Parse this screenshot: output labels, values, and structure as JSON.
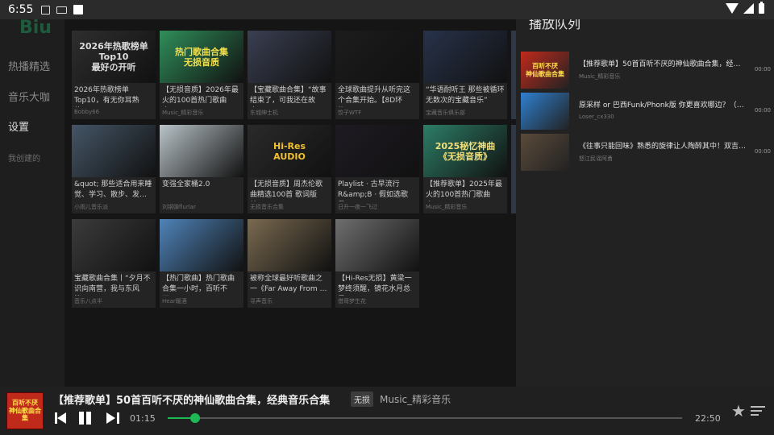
{
  "statusbar": {
    "time": "6:55"
  },
  "sidebar": {
    "logo": "Biu",
    "items": [
      {
        "label": "热播精选"
      },
      {
        "label": "音乐大咖"
      },
      {
        "label": "设置"
      }
    ],
    "section": "我创建的"
  },
  "grid": {
    "cards": [
      {
        "title": "2026年热歌榜单Top10，有无你耳熟的…",
        "author": "Bobby66",
        "overlay": "2026年热歌榜单Top10\n最好の开听",
        "bg": "#2e2e2e",
        "fg": "#dddddd"
      },
      {
        "title": "【无损音质】2026年最火的100首热门歌曲合…",
        "author": "Music_精彩音乐",
        "overlay": "热门歌曲合集\n无损音质",
        "bg": "#2f8e5a",
        "fg": "#f5e04a"
      },
      {
        "title": "【宝藏歌曲合集】“故事结束了，可我还在故事…",
        "author": "东城绅士机",
        "overlay": "",
        "bg": "#3a3f52",
        "fg": "#ffffff"
      },
      {
        "title": "全球歌曲提升从听完这个合集开始。【8D环绕…",
        "author": "饺子WTF",
        "overlay": "",
        "bg": "#1c1c1c",
        "fg": "#ffffff"
      },
      {
        "title": "“华语耐听王 那些被循环无数次的宝藏音乐”",
        "author": "宝藏音乐俱乐部",
        "overlay": "",
        "bg": "#27324a",
        "fg": "#ffffff"
      },
      {
        "title": "&quot; 那些适合用来睡觉、学习、散步、发…",
        "author": "小雨儿音乐派",
        "overlay": "",
        "bg": "#445566",
        "fg": "#ffffff"
      },
      {
        "title": "变强全家桶2.0",
        "author": "刘钢弹flurlar",
        "overlay": "",
        "bg": "#b9c3c8",
        "fg": "#333333"
      },
      {
        "title": "【无损音质】周杰伦歌曲精选100首 歌词版纯…",
        "author": "无损音乐合集",
        "overlay": "Hi-Res\nAUDIO",
        "bg": "#2a2a2a",
        "fg": "#f0c030"
      },
      {
        "title": "Playlist · 古早流行R&amp;B · 假如选歌是…",
        "author": "日升一夜一飞过",
        "overlay": "",
        "bg": "#1e1a22",
        "fg": "#ffffff"
      },
      {
        "title": "【推荐歌单】2025年最火的100首热门歌曲合…",
        "author": "Music_精彩音乐",
        "overlay": "2025秘忆神曲\n《无损音质》",
        "bg": "#2d7d66",
        "fg": "#f3e07a"
      },
      {
        "title": "宝藏歌曲合集丨“夕月不识向南营，我与东风皆…",
        "author": "音乐八点半",
        "overlay": "",
        "bg": "#3b3b3b",
        "fg": "#ffffff"
      },
      {
        "title": "【热门歌曲】热门歌曲合集一小时，百听不厌…",
        "author": "Hear暖酒",
        "overlay": "",
        "bg": "#4f83b8",
        "fg": "#f5e04a"
      },
      {
        "title": "被称全球最好听歌曲之一《Far Away From …",
        "author": "寻声音乐",
        "overlay": "",
        "bg": "#7a6a50",
        "fg": "#ffffff"
      },
      {
        "title": "【Hi-Res无损】黄梁一梦终须醒，镜花水月总是…",
        "author": "借哥梦生花",
        "overlay": "",
        "bg": "#6f6f6f",
        "fg": "#ffffff"
      }
    ]
  },
  "queue": {
    "title": "播放队列",
    "items": [
      {
        "title": "【推荐歌单】50首百听不厌的神仙歌曲合集，经典音…",
        "author": "Music_精彩音乐",
        "duration": "00:00",
        "overlay": "百听不厌\n神仙歌曲合集",
        "bg": "#c02a1b",
        "fg": "#ffe24a"
      },
      {
        "title": "原采样 or 巴西Funk/Phonk版 你更喜欢哪边？（九）",
        "author": "Loser_cx330",
        "duration": "00:00",
        "overlay": "",
        "bg": "#2f7fd0",
        "fg": "#ffffff"
      },
      {
        "title": "《往事只能回味》熟悉的旋律让人陶醉其中！双吉他…",
        "author": "怒江民谣阿勇",
        "duration": "00:00",
        "overlay": "",
        "bg": "#5a4a3a",
        "fg": "#ffffff"
      }
    ]
  },
  "player": {
    "title": "【推荐歌单】50首百听不厌的神仙歌曲合集，经典音乐合集",
    "badge": "无损",
    "artist": "Music_精彩音乐",
    "current_time": "01:15",
    "total_time": "22:50",
    "progress": 0.053,
    "cover_text": "百听不厌\n神仙歌曲合集",
    "accent": "#1db954"
  }
}
